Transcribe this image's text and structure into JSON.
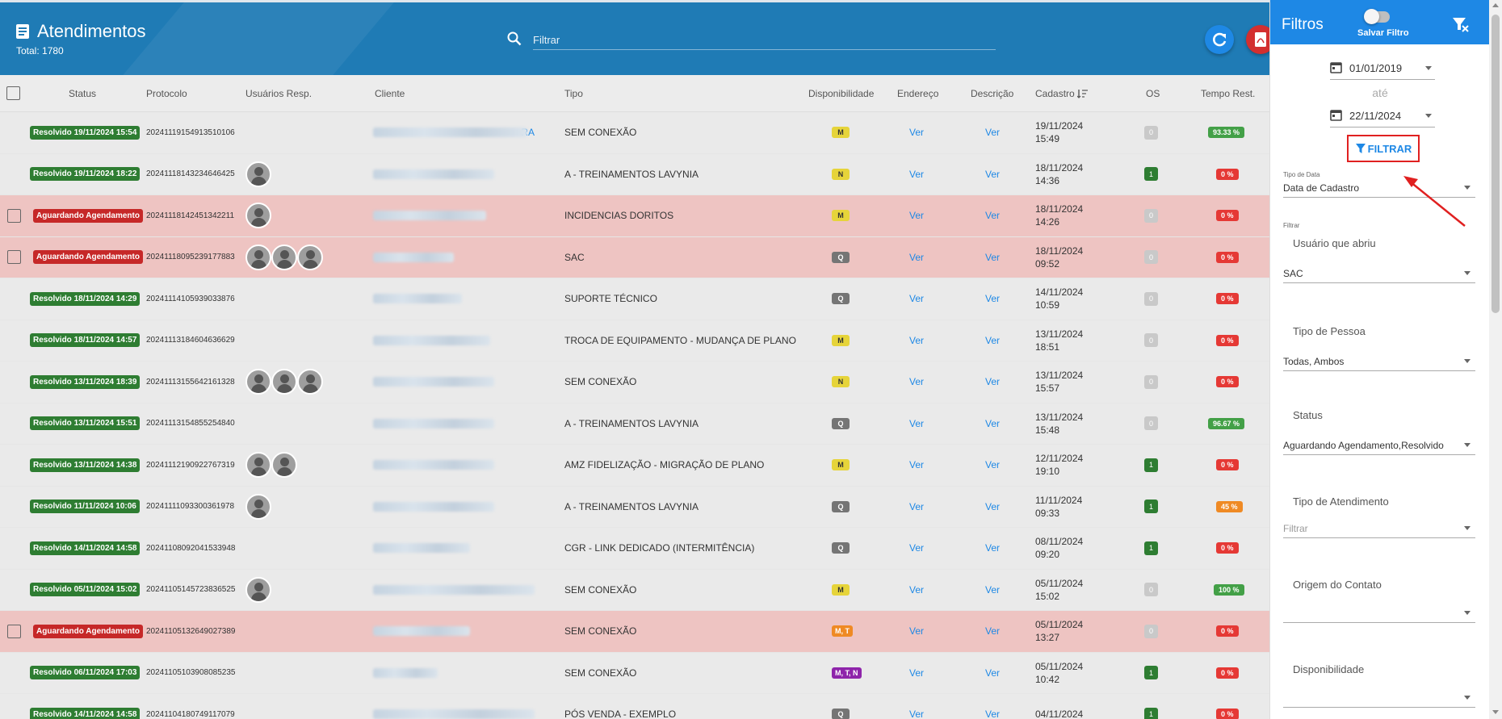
{
  "header": {
    "title": "Atendimentos",
    "total": "Total: 1780",
    "search_placeholder": "Filtrar"
  },
  "table": {
    "columns": [
      "Status",
      "Protocolo",
      "Usuários Resp.",
      "Cliente",
      "Tipo",
      "Disponibilidade",
      "Endereço",
      "Descrição",
      "Cadastro",
      "OS",
      "Tempo Rest."
    ],
    "link_label": "Ver",
    "rows": [
      {
        "status": "Resolvido 19/11/2024 15:54",
        "kind": "ok",
        "checkbox": false,
        "protocolo": "20241119154913510106",
        "avatars": 0,
        "client_suffix": "RA",
        "tipo": "SEM CONEXÃO",
        "disp": "M",
        "disp_kind": "M",
        "cad_date": "19/11/2024",
        "cad_time": "15:49",
        "os": "0",
        "tempo": "93.33 %",
        "tempo_kind": "g"
      },
      {
        "status": "Resolvido 19/11/2024 18:22",
        "kind": "ok",
        "checkbox": false,
        "protocolo": "20241118143234646425",
        "avatars": 1,
        "client_suffix": "",
        "tipo": "A - TREINAMENTOS LAVYNIA",
        "disp": "N",
        "disp_kind": "N",
        "cad_date": "18/11/2024",
        "cad_time": "14:36",
        "os": "1",
        "tempo": "0 %",
        "tempo_kind": "r"
      },
      {
        "status": "Aguardando Agendamento",
        "kind": "wait",
        "checkbox": true,
        "protocolo": "20241118142451342211",
        "avatars": 1,
        "client_suffix": "",
        "tipo": "INCIDENCIAS DORITOS",
        "disp": "M",
        "disp_kind": "M",
        "cad_date": "18/11/2024",
        "cad_time": "14:26",
        "os": "0",
        "tempo": "0 %",
        "tempo_kind": "r"
      },
      {
        "status": "Aguardando Agendamento",
        "kind": "wait",
        "checkbox": true,
        "protocolo": "20241118095239177883",
        "avatars": 3,
        "client_suffix": "",
        "tipo": "SAC",
        "disp": "Q",
        "disp_kind": "Q",
        "cad_date": "18/11/2024",
        "cad_time": "09:52",
        "os": "0",
        "tempo": "0 %",
        "tempo_kind": "r"
      },
      {
        "status": "Resolvido 18/11/2024 14:29",
        "kind": "ok",
        "checkbox": false,
        "protocolo": "20241114105939033876",
        "avatars": 0,
        "client_suffix": "",
        "tipo": "SUPORTE TÉCNICO",
        "disp": "Q",
        "disp_kind": "Q",
        "cad_date": "14/11/2024",
        "cad_time": "10:59",
        "os": "0",
        "tempo": "0 %",
        "tempo_kind": "r"
      },
      {
        "status": "Resolvido 18/11/2024 14:57",
        "kind": "ok",
        "checkbox": false,
        "protocolo": "20241113184604636629",
        "avatars": 0,
        "client_suffix": "",
        "tipo": "TROCA DE EQUIPAMENTO - MUDANÇA DE PLANO",
        "disp": "M",
        "disp_kind": "M",
        "cad_date": "13/11/2024",
        "cad_time": "18:51",
        "os": "0",
        "tempo": "0 %",
        "tempo_kind": "r"
      },
      {
        "status": "Resolvido 13/11/2024 18:39",
        "kind": "ok",
        "checkbox": false,
        "protocolo": "20241113155642161328",
        "avatars": 3,
        "client_suffix": "",
        "tipo": "SEM CONEXÃO",
        "disp": "N",
        "disp_kind": "N",
        "cad_date": "13/11/2024",
        "cad_time": "15:57",
        "os": "0",
        "tempo": "0 %",
        "tempo_kind": "r"
      },
      {
        "status": "Resolvido 13/11/2024 15:51",
        "kind": "ok",
        "checkbox": false,
        "protocolo": "20241113154855254840",
        "avatars": 0,
        "client_suffix": "",
        "tipo": "A - TREINAMENTOS LAVYNIA",
        "disp": "Q",
        "disp_kind": "Q",
        "cad_date": "13/11/2024",
        "cad_time": "15:48",
        "os": "0",
        "tempo": "96.67 %",
        "tempo_kind": "g"
      },
      {
        "status": "Resolvido 13/11/2024 14:38",
        "kind": "ok",
        "checkbox": false,
        "protocolo": "20241112190922767319",
        "avatars": 2,
        "client_suffix": "",
        "tipo": "AMZ FIDELIZAÇÃO - MIGRAÇÃO DE PLANO",
        "disp": "M",
        "disp_kind": "M",
        "cad_date": "12/11/2024",
        "cad_time": "19:10",
        "os": "1",
        "tempo": "0 %",
        "tempo_kind": "r"
      },
      {
        "status": "Resolvido 11/11/2024 10:06",
        "kind": "ok",
        "checkbox": false,
        "protocolo": "20241111093300361978",
        "avatars": 1,
        "client_suffix": "",
        "tipo": "A - TREINAMENTOS LAVYNIA",
        "disp": "Q",
        "disp_kind": "Q",
        "cad_date": "11/11/2024",
        "cad_time": "09:33",
        "os": "1",
        "tempo": "45 %",
        "tempo_kind": "o"
      },
      {
        "status": "Resolvido 14/11/2024 14:58",
        "kind": "ok",
        "checkbox": false,
        "protocolo": "20241108092041533948",
        "avatars": 0,
        "client_suffix": "",
        "tipo": "CGR - LINK DEDICADO (INTERMITÊNCIA)",
        "disp": "Q",
        "disp_kind": "Q",
        "cad_date": "08/11/2024",
        "cad_time": "09:20",
        "os": "1",
        "tempo": "0 %",
        "tempo_kind": "r"
      },
      {
        "status": "Resolvido 05/11/2024 15:02",
        "kind": "ok",
        "checkbox": false,
        "protocolo": "20241105145723836525",
        "avatars": 1,
        "client_suffix": "",
        "tipo": "SEM CONEXÃO",
        "disp": "M",
        "disp_kind": "M",
        "cad_date": "05/11/2024",
        "cad_time": "15:02",
        "os": "0",
        "tempo": "100 %",
        "tempo_kind": "g"
      },
      {
        "status": "Aguardando Agendamento",
        "kind": "wait",
        "checkbox": true,
        "protocolo": "20241105132649027389",
        "avatars": 0,
        "client_suffix": "",
        "tipo": "SEM CONEXÃO",
        "disp": "M, T",
        "disp_kind": "MT",
        "cad_date": "05/11/2024",
        "cad_time": "13:27",
        "os": "0",
        "tempo": "0 %",
        "tempo_kind": "r"
      },
      {
        "status": "Resolvido 06/11/2024 17:03",
        "kind": "ok",
        "checkbox": false,
        "protocolo": "20241105103908085235",
        "avatars": 0,
        "client_suffix": "",
        "tipo": "SEM CONEXÃO",
        "disp": "M, T, N",
        "disp_kind": "MTN",
        "cad_date": "05/11/2024",
        "cad_time": "10:42",
        "os": "1",
        "tempo": "0 %",
        "tempo_kind": "r"
      },
      {
        "status": "Resolvido 14/11/2024 14:58",
        "kind": "ok",
        "checkbox": false,
        "protocolo": "20241104180749117079",
        "avatars": 0,
        "client_suffix": "",
        "tipo": "PÓS VENDA - EXEMPLO",
        "disp": "Q",
        "disp_kind": "Q",
        "cad_date": "04/11/2024",
        "cad_time": "",
        "os": "1",
        "tempo": "0 %",
        "tempo_kind": "r"
      }
    ]
  },
  "filters": {
    "title": "Filtros",
    "save_label": "Salvar Filtro",
    "save_enabled": false,
    "date_from": "01/01/2019",
    "date_sep": "até",
    "date_to": "22/11/2024",
    "apply_label": "FILTRAR",
    "tipo_data_label": "Tipo de Data",
    "tipo_data_value": "Data de Cadastro",
    "filtrar_label": "Filtrar",
    "usuario_label": "Usuário que abriu",
    "usuario_value": "SAC",
    "tipo_pessoa_label": "Tipo de Pessoa",
    "tipo_pessoa_value": "Todas, Ambos",
    "status_label": "Status",
    "status_value": "Aguardando Agendamento,Resolvido",
    "tipo_atendimento_label": "Tipo de Atendimento",
    "tipo_atendimento_placeholder": "Filtrar",
    "origem_label": "Origem do Contato",
    "disponibilidade_label": "Disponibilidade"
  },
  "colors": {
    "header_bg": "#1f7bb5",
    "accent": "#1e88e5",
    "resolved": "#2e7d32",
    "pending": "#c62828",
    "pending_row": "#eec4c2",
    "highlight": "#e02020"
  },
  "icons": [
    "document-icon",
    "search-icon",
    "refresh-icon",
    "pdf-icon",
    "filter-clear-icon",
    "calendar-icon",
    "filter-icon",
    "sort-icon",
    "user-avatar-icon",
    "arrow-annotation"
  ]
}
